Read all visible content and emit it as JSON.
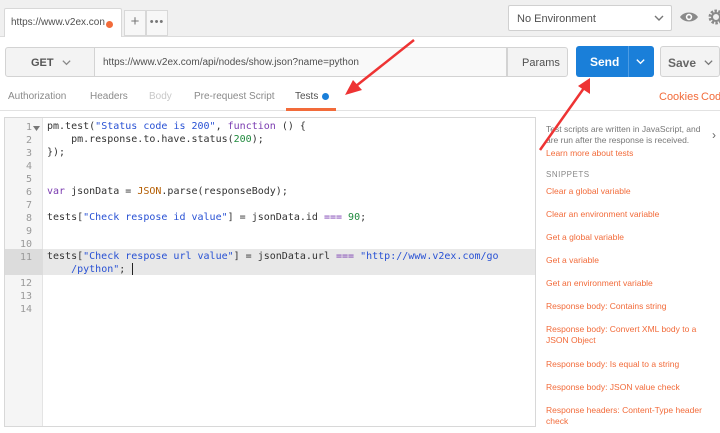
{
  "tabbar": {
    "request_tab_label": "https://www.v2ex.con",
    "add_tab": "+",
    "more_tabs": "•••",
    "environment": "No Environment"
  },
  "request": {
    "method": "GET",
    "url": "https://www.v2ex.com/api/nodes/show.json?name=python",
    "params_label": "Params",
    "send_label": "Send",
    "save_label": "Save"
  },
  "subtabs": {
    "authorization": "Authorization",
    "headers": "Headers",
    "body": "Body",
    "pre_request": "Pre-request Script",
    "tests": "Tests"
  },
  "links": {
    "cookies": "Cookies",
    "code": "Code"
  },
  "editor": {
    "line_numbers": [
      "1",
      "2",
      "3",
      "4",
      "5",
      "6",
      "7",
      "8",
      "9",
      "10",
      "11",
      "12",
      "13",
      "14"
    ],
    "code": {
      "l1_a": "pm.test(",
      "l1_str": "\"Status code is 200\"",
      "l1_b": ", ",
      "l1_kw": "function",
      "l1_c": " () {",
      "l2_a": "    pm.response.to.have.status(",
      "l2_num": "200",
      "l2_b": ");",
      "l3": "});",
      "l6_kw": "var",
      "l6_a": " jsonData = ",
      "l6_json": "JSON",
      "l6_b": ".parse(responseBody);",
      "l8_a": "tests[",
      "l8_str": "\"Check respose id value\"",
      "l8_b": "] = jsonData.id ",
      "l8_op": "===",
      "l8_sp": " ",
      "l8_num": "90",
      "l8_c": ";",
      "l11_a": "tests[",
      "l11_str": "\"Check respose url value\"",
      "l11_b": "] = jsonData.url ",
      "l11_op": "===",
      "l11_sp": " ",
      "l11_str2": "\"http://www.v2ex.com/go",
      "l11w_pad": "    ",
      "l11w_str": "/python\"",
      "l11w_end": ";"
    }
  },
  "sidebar": {
    "help": "Test scripts are written in JavaScript, and are run after the response is received.",
    "learn_more": "Learn more about tests",
    "snippets_heading": "SNIPPETS",
    "snippets": [
      "Clear a global variable",
      "Clear an environment variable",
      "Get a global variable",
      "Get a variable",
      "Get an environment variable",
      "Response body: Contains string",
      "Response body: Convert XML body to a JSON Object",
      "Response body: Is equal to a string",
      "Response body: JSON value check",
      "Response headers: Content-Type header check"
    ]
  },
  "colors": {
    "accent": "#f26b3a",
    "send": "#1a7fd9",
    "annotation_arrow": "#ee3333"
  }
}
